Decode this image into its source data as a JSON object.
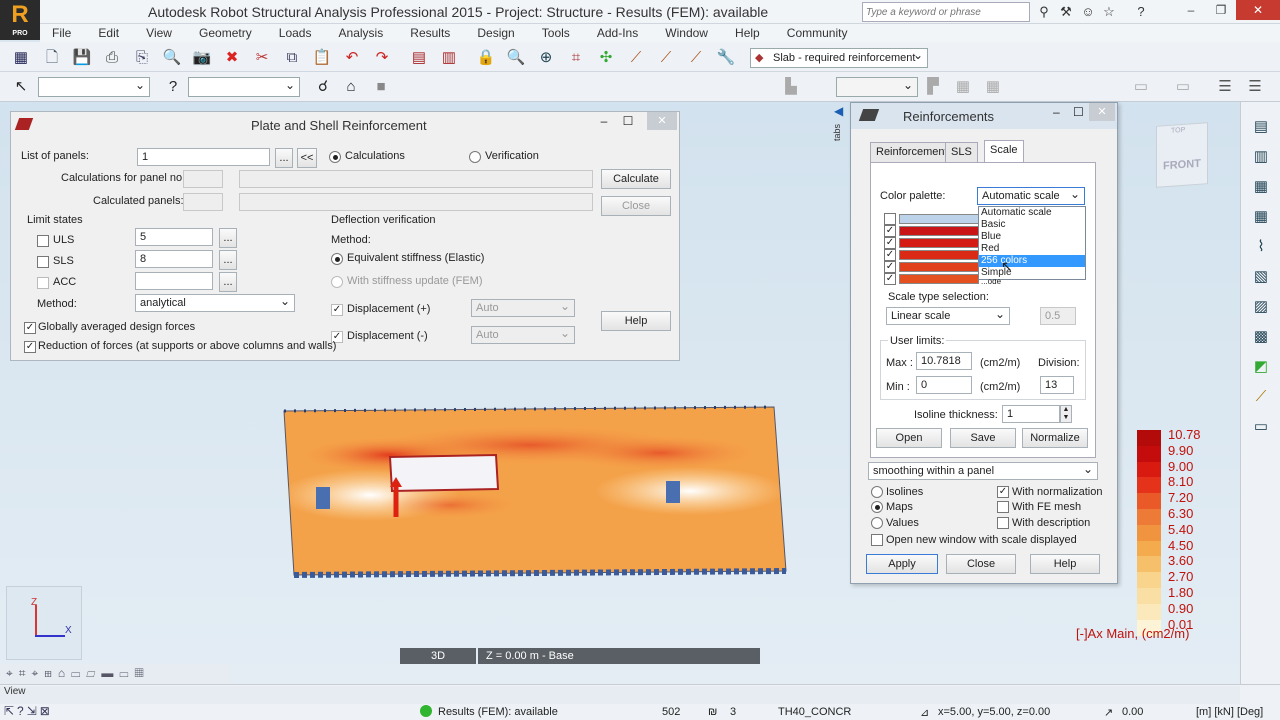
{
  "app": {
    "title": "Autodesk Robot Structural Analysis Professional 2015 - Project: Structure - Results (FEM): available",
    "logo_badge": "PRO",
    "search_placeholder": "Type a keyword or phrase"
  },
  "menu": [
    "File",
    "Edit",
    "View",
    "Geometry",
    "Loads",
    "Analysis",
    "Results",
    "Design",
    "Tools",
    "Add-Ins",
    "Window",
    "Help",
    "Community"
  ],
  "toolbar": {
    "slab_selector": "Slab - required reinforcement",
    "tabs_label": "tabs"
  },
  "plate_dialog": {
    "title": "Plate and Shell Reinforcement",
    "list_of_panels_label": "List of panels:",
    "list_of_panels_value": "1",
    "browse_btn": "...",
    "back_btn": "<<",
    "calculations_label": "Calculations",
    "verification_label": "Verification",
    "calc_for_panel_label": "Calculations for panel no.:",
    "calculated_panels_label": "Calculated panels:",
    "calculate_btn": "Calculate",
    "close_btn": "Close",
    "limit_states_label": "Limit states",
    "uls_label": "ULS",
    "uls_value": "5",
    "sls_label": "SLS",
    "sls_value": "8",
    "acc_label": "ACC",
    "method_label": "Method:",
    "method_value": "analytical",
    "deflection_label": "Deflection verification",
    "def_method_label": "Method:",
    "equiv_stiffness_label": "Equivalent stiffness (Elastic)",
    "stiffness_update_label": "With stiffness update (FEM)",
    "disp_plus_label": "Displacement (+)",
    "disp_minus_label": "Displacement (-)",
    "auto_value": "Auto",
    "help_btn": "Help",
    "global_avg_label": "Globally averaged design forces",
    "reduction_label": "Reduction of forces (at supports or above columns and walls)"
  },
  "reinf_dialog": {
    "title": "Reinforcements",
    "tabs": [
      "Reinforcement",
      "SLS",
      "Scale"
    ],
    "color_palette_label": "Color palette:",
    "color_palette_value": "Automatic scale",
    "palette_options": [
      "Automatic scale",
      "Basic",
      "Blue",
      "Red",
      "256 colors",
      "Simple",
      "...ode"
    ],
    "scale_type_label": "Scale type selection:",
    "scale_type_value": "Linear scale",
    "scale_param": "0.5",
    "user_limits_label": "User limits:",
    "max_label": "Max :",
    "max_value": "10.7818",
    "min_label": "Min :",
    "min_value": "0",
    "unit": "(cm2/m)",
    "division_label": "Division:",
    "division_value": "13",
    "isoline_label": "Isoline thickness:",
    "isoline_value": "1",
    "open_btn": "Open",
    "save_btn": "Save",
    "normalize_btn": "Normalize",
    "smoothing_value": "smoothing within a panel",
    "isolines_label": "Isolines",
    "maps_label": "Maps",
    "values_label": "Values",
    "with_normalization_label": "With normalization",
    "with_fe_mesh_label": "With FE mesh",
    "with_description_label": "With description",
    "open_new_window_label": "Open new window with scale displayed",
    "apply_btn": "Apply",
    "close_btn": "Close",
    "help_btn": "Help"
  },
  "legend": {
    "values": [
      "10.78",
      "9.90",
      "9.00",
      "8.10",
      "7.20",
      "6.30",
      "5.40",
      "4.50",
      "3.60",
      "2.70",
      "1.80",
      "0.90",
      "0.01"
    ],
    "colors": [
      "#b30a0a",
      "#c40c0c",
      "#d81a10",
      "#e4331a",
      "#ea5a28",
      "#ee7a38",
      "#f1943f",
      "#f4ab4d",
      "#f6c06a",
      "#f8d48c",
      "#fadfa4",
      "#fbe8bb",
      "#fdf4d8"
    ],
    "title": "[-]Ax Main, (cm2/m)"
  },
  "view": {
    "view_3d": "3D",
    "level": "Z = 0.00 m - Base",
    "cube_top": "TOP",
    "cube_front": "FRONT",
    "axis_z": "Z",
    "axis_x": "X"
  },
  "status": {
    "view_label": "View",
    "results": "Results (FEM): available",
    "count": "502",
    "sec_num": "3",
    "material": "TH40_CONCR",
    "coords": "x=5.00, y=5.00, z=0.00",
    "value": "0.00",
    "units": "[m] [kN] [Deg]"
  }
}
